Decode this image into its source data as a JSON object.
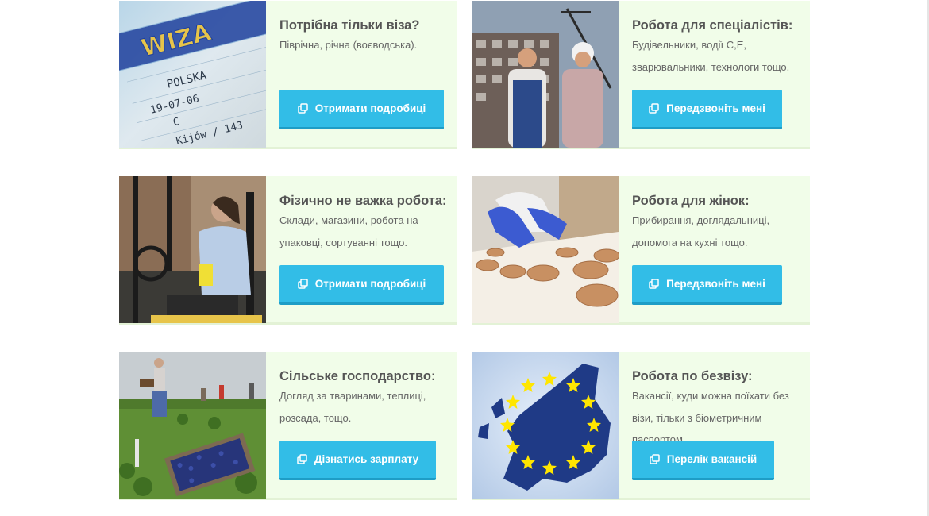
{
  "cards": [
    {
      "image_name": "polish-visa-photo",
      "title": "Потрібна тільки віза?",
      "text": "Піврічна, річна (воєводська).",
      "button": "Отримати подробиці",
      "button_icon": "copy-icon"
    },
    {
      "image_name": "construction-workers-photo",
      "title": "Робота для спеціалістів:",
      "text": "Будівельники, водії C,E, зварювальники, технологи тощо.",
      "button": "Передзвоніть мені",
      "button_icon": "copy-icon"
    },
    {
      "image_name": "forklift-driver-photo",
      "title": "Фізично не важка робота:",
      "text": "Склади, магазини, робота на упаковці, сортуванні тощо.",
      "button": "Отримати подробиці",
      "button_icon": "copy-icon"
    },
    {
      "image_name": "cookie-factory-photo",
      "title": "Робота для жінок:",
      "text": "Прибирання, доглядальниці, допомога на кухні тощо.",
      "button": "Передзвоніть мені",
      "button_icon": "copy-icon"
    },
    {
      "image_name": "blueberry-field-photo",
      "title": "Сільське господарство:",
      "text": "Догляд за тваринами, теплиці, розсада, тощо.",
      "button": "Дізнатись зарплату",
      "button_icon": "copy-icon"
    },
    {
      "image_name": "eu-map-stars-photo",
      "title": "Робота по безвізу:",
      "text": "Вакансії, куди можна поїхати без візи, тільки з біометричним паспортом.",
      "button": "Перелік вакансій",
      "button_icon": "copy-icon"
    }
  ],
  "visa_image_text": {
    "wiza": "WIZA",
    "country": "POLSKA",
    "date": "19-07-06",
    "type": "C",
    "place": "Kijów / 143"
  },
  "colors": {
    "card_bg": "#f1fde9",
    "button": "#32bde7",
    "title": "#555555",
    "text": "#666666"
  }
}
